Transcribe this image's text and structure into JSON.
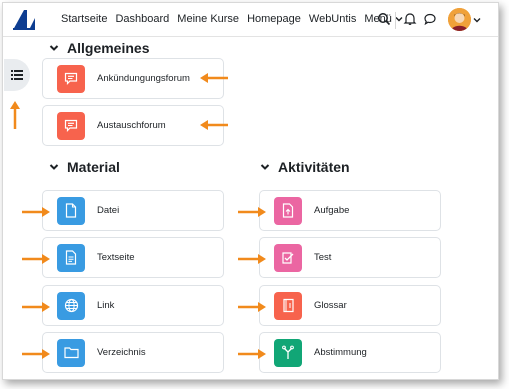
{
  "nav": {
    "items": [
      "Startseite",
      "Dashboard",
      "Meine Kurse",
      "Homepage",
      "WebUntis"
    ],
    "menu_label": "Menü"
  },
  "sections": {
    "general": {
      "title": "Allgemeines",
      "items": [
        {
          "label": "Ankündungungsforum",
          "icon": "forum-icon",
          "color": "#f7634d"
        },
        {
          "label": "Austauschforum",
          "icon": "forum-icon",
          "color": "#f7634d"
        }
      ]
    },
    "material": {
      "title": "Material",
      "items": [
        {
          "label": "Datei",
          "icon": "file-icon",
          "color": "#399be2"
        },
        {
          "label": "Textseite",
          "icon": "page-icon",
          "color": "#399be2"
        },
        {
          "label": "Link",
          "icon": "globe-icon",
          "color": "#399be2"
        },
        {
          "label": "Verzeichnis",
          "icon": "folder-icon",
          "color": "#399be2"
        }
      ]
    },
    "activities": {
      "title": "Aktivitäten",
      "items": [
        {
          "label": "Aufgabe",
          "icon": "assignment-icon",
          "color": "#eb66a2"
        },
        {
          "label": "Test",
          "icon": "quiz-icon",
          "color": "#eb66a2"
        },
        {
          "label": "Glossar",
          "icon": "glossary-icon",
          "color": "#f7634d"
        },
        {
          "label": "Abstimmung",
          "icon": "choice-icon",
          "color": "#11a676"
        }
      ]
    }
  },
  "colors": {
    "arrow": "#f18a1c",
    "accent": "#0f6cbf"
  }
}
